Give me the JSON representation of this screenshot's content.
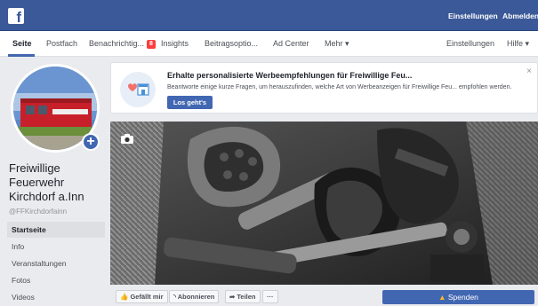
{
  "topbar": {
    "logo": "f",
    "settings_label": "Einstellungen",
    "logout_label": "Abmelden"
  },
  "tabs": {
    "page": "Seite",
    "inbox": "Postfach",
    "notifications": "Benachrichtig...",
    "notifications_badge": "8",
    "insights": "Insights",
    "post_options": "Beitragsoptio...",
    "ad_center": "Ad Center",
    "more": "Mehr ▾",
    "settings": "Einstellungen",
    "help": "Hilfe ▾"
  },
  "page": {
    "name": "Freiwillige Feuerwehr Kirchdorf a.Inn",
    "handle": "@FFKirchdorfainn"
  },
  "nav": {
    "items": [
      "Startseite",
      "Info",
      "Veranstaltungen",
      "Fotos",
      "Videos"
    ]
  },
  "promo": {
    "title": "Erhalte personalisierte Werbeempfehlungen für Freiwillige Feu...",
    "text": "Beantworte einige kurze Fragen, um herauszufinden, welche Art von Werbeanzeigen für Freiwillige Feu... empfohlen werden.",
    "button": "Los geht's",
    "close": "×"
  },
  "actions": {
    "like": "Gefällt mir",
    "subscribe": "Abonnieren",
    "share": "Teilen",
    "more": "···",
    "donate": "Spenden"
  },
  "colors": {
    "brand": "#3b5998",
    "accent": "#4267b2",
    "badge": "#fa3e3e"
  }
}
